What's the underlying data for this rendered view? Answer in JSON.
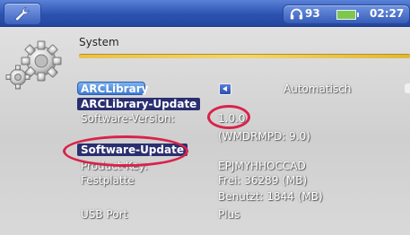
{
  "statusbar": {
    "volume": "93",
    "time": "02:27"
  },
  "section": {
    "title": "System"
  },
  "rows": [
    {
      "label": "ARCLibrary",
      "value": "Automatisch"
    },
    {
      "label": "ARCLibrary-Update",
      "value": ""
    },
    {
      "label": "Software-Version:",
      "value": "1.0.0",
      "value2": "(WMDRMPD: 9.0)"
    },
    {
      "label": "Software-Update",
      "value": ""
    },
    {
      "label": "Product-Key:",
      "value": "EPJMYHHOCCAD"
    },
    {
      "label": "Festplatte",
      "value": "Frei: 36289 (MB)",
      "value2": "Benutzt: 1844 (MB)"
    },
    {
      "label": "USB Port",
      "value": "Plus"
    }
  ],
  "colors": {
    "topbar": "#2b53b0",
    "separator": "#e8c24a",
    "highlight_circle": "#d8234a",
    "selected_row": "#3f7bd0"
  },
  "icons": [
    "wrench-icon",
    "headphones-icon",
    "battery-icon",
    "gear-icon",
    "left-arrow-icon",
    "right-arrow-icon"
  ]
}
